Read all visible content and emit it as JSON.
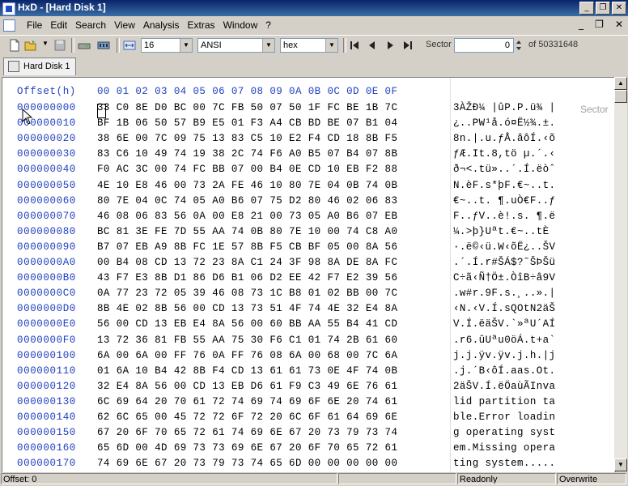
{
  "window": {
    "title": "HxD - [Hard Disk 1]",
    "min_glyph": "_",
    "max_glyph": "❐",
    "close_glyph": "✕"
  },
  "menu": {
    "items": [
      "File",
      "Edit",
      "Search",
      "View",
      "Analysis",
      "Extras",
      "Window",
      "?"
    ],
    "mdi_min": "_",
    "mdi_restore": "❐",
    "mdi_close": "✕"
  },
  "toolbar": {
    "bytes_per_row": "16",
    "charset": "ANSI",
    "offset_base": "hex",
    "sector_label": "Sector",
    "sector_value": "0",
    "sector_total": "of 50331648",
    "icons": [
      "new-icon",
      "open-icon",
      "save-icon",
      "drive-icon",
      "ram-icon",
      "row-width-icon",
      "first-icon",
      "prev-icon",
      "next-icon",
      "last-icon"
    ]
  },
  "tab": {
    "label": "Hard Disk 1"
  },
  "hex_view": {
    "header_offset": "Offset(h)",
    "header_columns": "00 01 02 03 04 05 06 07 08 09 0A 0B 0C 0D 0E 0F",
    "sector_overlay": "Sector",
    "rows": [
      {
        "offset": "000000000",
        "hex": "33 C0 8E D0 BC 00 7C FB 50 07 50 1F FC BE 1B 7C",
        "ascii": "3ÀŽÐ¼ |ûP.P.ü¾ |"
      },
      {
        "offset": "000000010",
        "hex": "BF 1B 06 50 57 B9 E5 01 F3 A4 CB BD BE 07 B1 04",
        "ascii": "¿..PW¹å.ó¤Ë½¾.±."
      },
      {
        "offset": "000000020",
        "hex": "38 6E 00 7C 09 75 13 83 C5 10 E2 F4 CD 18 8B F5",
        "ascii": "8n.|.u.ƒÅ.âôÍ.‹õ"
      },
      {
        "offset": "000000030",
        "hex": "83 C6 10 49 74 19 38 2C 74 F6 A0 B5 07 B4 07 8B",
        "ascii": "ƒÆ.It.8,tö µ.´.‹"
      },
      {
        "offset": "000000040",
        "hex": "F0 AC 3C 00 74 FC BB 07 00 B4 0E CD 10 EB F2 88",
        "ascii": "ð¬<.tü»..´.Í.ëòˆ"
      },
      {
        "offset": "000000050",
        "hex": "4E 10 E8 46 00 73 2A FE 46 10 80 7E 04 0B 74 0B",
        "ascii": "N.èF.s*þF.€~..t."
      },
      {
        "offset": "000000060",
        "hex": "80 7E 04 0C 74 05 A0 B6 07 75 D2 80 46 02 06 83",
        "ascii": "€~..t. ¶.uÒ€F..ƒ"
      },
      {
        "offset": "000000070",
        "hex": "46 08 06 83 56 0A 00 E8 21 00 73 05 A0 B6 07 EB",
        "ascii": "F..ƒV..è!.s. ¶.ë"
      },
      {
        "offset": "000000080",
        "hex": "BC 81 3E FE 7D 55 AA 74 0B 80 7E 10 00 74 C8 A0",
        "ascii": "¼.>þ}Uªt.€~..tÈ "
      },
      {
        "offset": "000000090",
        "hex": "B7 07 EB A9 8B FC 1E 57 8B F5 CB BF 05 00 8A 56",
        "ascii": "·.ë©‹ü.W‹õË¿..ŠV"
      },
      {
        "offset": "0000000A0",
        "hex": "00 B4 08 CD 13 72 23 8A C1 24 3F 98 8A DE 8A FC",
        "ascii": ".´.Í.r#ŠÁ$?˜ŠÞŠü"
      },
      {
        "offset": "0000000B0",
        "hex": "43 F7 E3 8B D1 86 D6 B1 06 D2 EE 42 F7 E2 39 56",
        "ascii": "C÷ã‹Ñ†Ö±.ÒîB÷â9V"
      },
      {
        "offset": "0000000C0",
        "hex": "0A 77 23 72 05 39 46 08 73 1C B8 01 02 BB 00 7C",
        "ascii": ".w#r.9F.s.¸..».|"
      },
      {
        "offset": "0000000D0",
        "hex": "8B 4E 02 8B 56 00 CD 13 73 51 4F 74 4E 32 E4 8A",
        "ascii": "‹N.‹V.Í.sQOtN2äŠ"
      },
      {
        "offset": "0000000E0",
        "hex": "56 00 CD 13 EB E4 8A 56 00 60 BB AA 55 B4 41 CD",
        "ascii": "V.Í.ëäŠV.`»ªU´AÍ"
      },
      {
        "offset": "0000000F0",
        "hex": "13 72 36 81 FB 55 AA 75 30 F6 C1 01 74 2B 61 60",
        "ascii": ".r6.ûUªu0öÁ.t+a`"
      },
      {
        "offset": "000000100",
        "hex": "6A 00 6A 00 FF 76 0A FF 76 08 6A 00 68 00 7C 6A",
        "ascii": "j.j.ÿv.ÿv.j.h.|j"
      },
      {
        "offset": "000000110",
        "hex": "01 6A 10 B4 42 8B F4 CD 13 61 61 73 0E 4F 74 0B",
        "ascii": ".j.´B‹ôÍ.aas.Ot."
      },
      {
        "offset": "000000120",
        "hex": "32 E4 8A 56 00 CD 13 EB D6 61 F9 C3 49 6E 76 61",
        "ascii": "2äŠV.Í.ëÖaùÃInva"
      },
      {
        "offset": "000000130",
        "hex": "6C 69 64 20 70 61 72 74 69 74 69 6F 6E 20 74 61",
        "ascii": "lid partition ta"
      },
      {
        "offset": "000000140",
        "hex": "62 6C 65 00 45 72 72 6F 72 20 6C 6F 61 64 69 6E",
        "ascii": "ble.Error loadin"
      },
      {
        "offset": "000000150",
        "hex": "67 20 6F 70 65 72 61 74 69 6E 67 20 73 79 73 74",
        "ascii": "g operating syst"
      },
      {
        "offset": "000000160",
        "hex": "65 6D 00 4D 69 73 73 69 6E 67 20 6F 70 65 72 61",
        "ascii": "em.Missing opera"
      },
      {
        "offset": "000000170",
        "hex": "74 69 6E 67 20 73 79 73 74 65 6D 00 00 00 00 00",
        "ascii": "ting system....."
      }
    ]
  },
  "status": {
    "offset": "Offset: 0",
    "mode": "Readonly",
    "insert_mode": "Overwrite"
  },
  "colors": {
    "title_start": "#0a246a",
    "title_end": "#3a6ea5",
    "offset_text": "#1f3fbf",
    "chrome": "#d4d0c8"
  }
}
